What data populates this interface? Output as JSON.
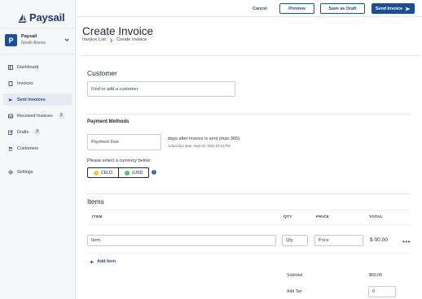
{
  "brand": {
    "name": "Paysail"
  },
  "account": {
    "initial": "P",
    "name": "Paysail",
    "user": "Nicole Alonso"
  },
  "sidebar": {
    "items": [
      {
        "label": "Dashboard",
        "icon": "dashboard-icon"
      },
      {
        "label": "Invoices",
        "icon": "document-icon"
      },
      {
        "label": "Sent Invoices",
        "icon": "send-icon",
        "active": true
      },
      {
        "label": "Received Invoices",
        "icon": "inbox-icon",
        "badge": "3"
      },
      {
        "label": "Drafts",
        "icon": "edit-icon",
        "badge": "3"
      },
      {
        "label": "Customers",
        "icon": "users-icon"
      },
      {
        "label": "Settings",
        "icon": "gear-icon"
      }
    ]
  },
  "toolbar": {
    "cancel_label": "Cancel",
    "preview_label": "Preview",
    "draft_label": "Save as Draft",
    "send_label": "Send Invoice"
  },
  "page": {
    "title": "Create Invoice",
    "breadcrumb": [
      "Invoice List",
      "Create Invoice"
    ]
  },
  "customer": {
    "heading": "Customer",
    "placeholder": "Find or add a customer"
  },
  "payment": {
    "heading": "Payment Methods",
    "due_placeholder": "Payment Due",
    "due_hint": "days after invoice is sent (max.365)",
    "due_date": "Actual due date: Sept 02, 2021 10:14 PM",
    "currency_prompt": "Please select a currency below:",
    "currencies": [
      {
        "label": "CELO",
        "color": "#f5c64a"
      },
      {
        "label": "cUSD",
        "color": "#5fbf6f"
      }
    ]
  },
  "items": {
    "heading": "Items",
    "columns": {
      "item": "ITEM",
      "qty": "QTY",
      "price": "PRICE",
      "total": "TOTAL"
    },
    "row": {
      "item_placeholder": "Item",
      "qty_placeholder": "Qty",
      "price_placeholder": "Price",
      "total": "$ 00.00"
    },
    "add_label": "Add item",
    "subtotal_label": "Subtotal",
    "subtotal_value": "$50.00",
    "tax_label": "Add Tax",
    "tax_value": "0"
  },
  "colors": {
    "brand": "#1f4e8c",
    "text": "#1d2433",
    "border": "#e3e6ea"
  }
}
